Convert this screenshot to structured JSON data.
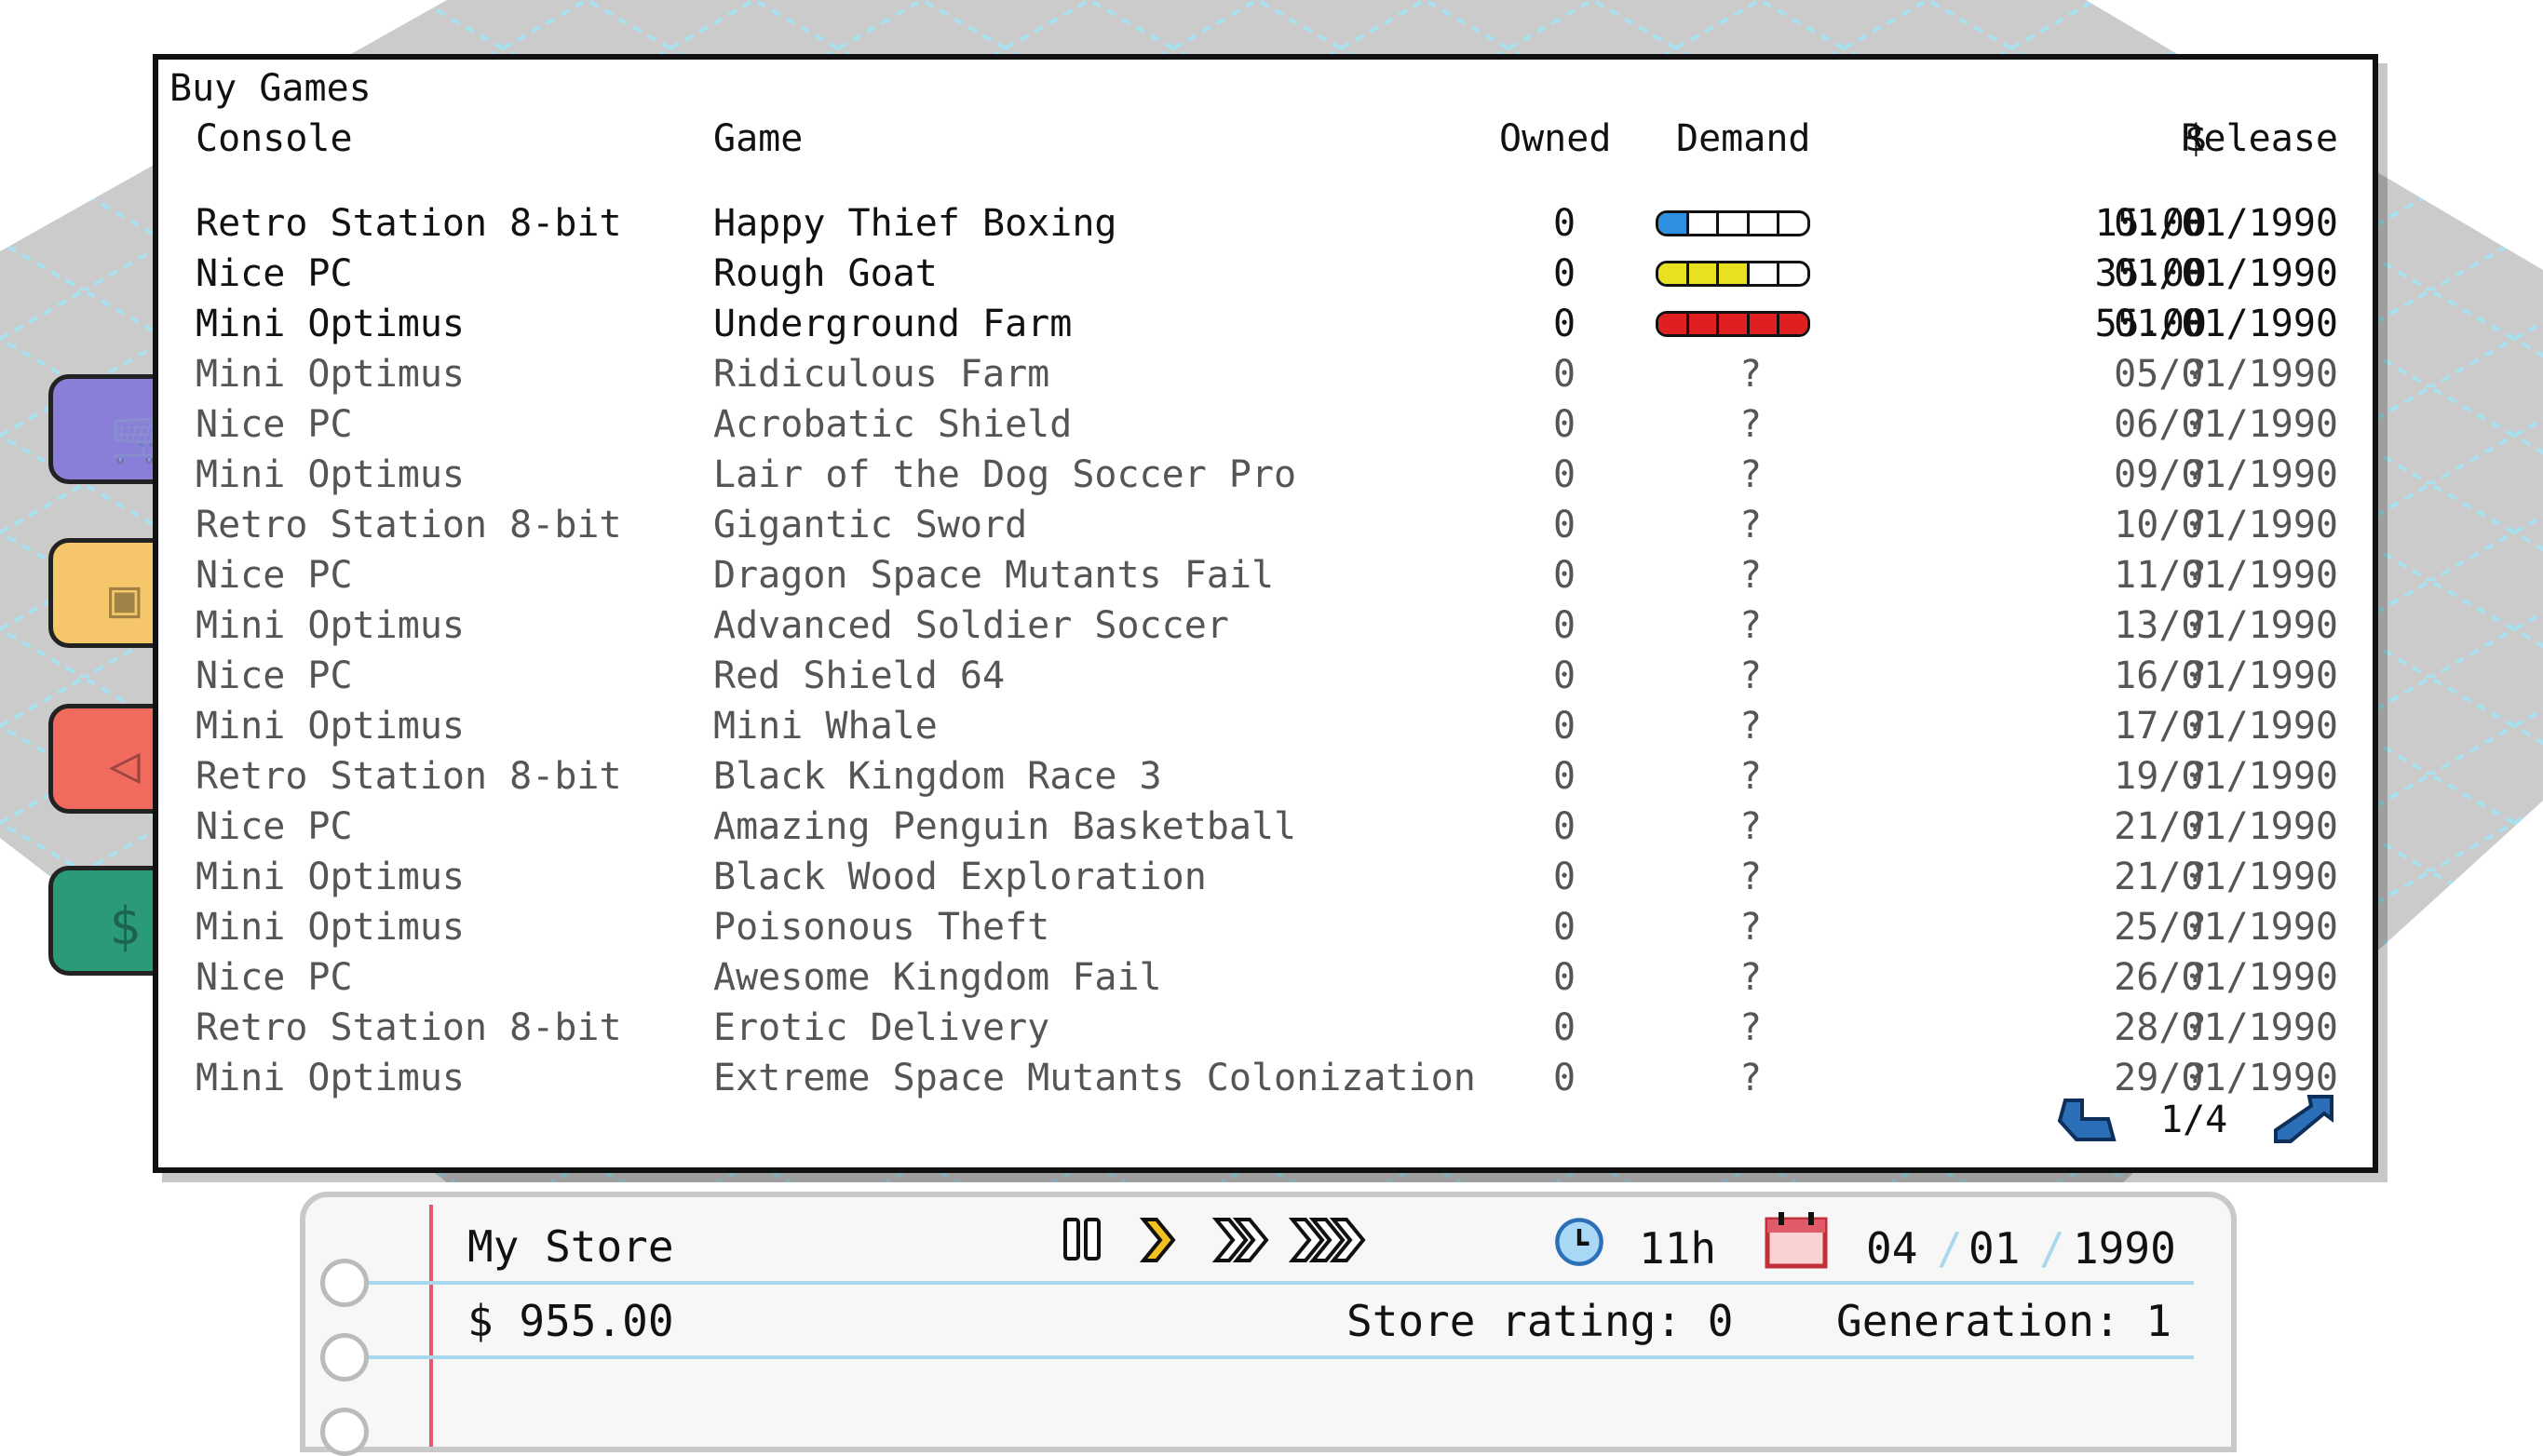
{
  "window": {
    "title": "Buy Games"
  },
  "columns": {
    "console": "Console",
    "game": "Game",
    "owned": "Owned",
    "demand": "Demand",
    "price": "$",
    "release": "Release"
  },
  "rows": [
    {
      "console": "Retro Station 8-bit",
      "game": "Happy Thief Boxing",
      "owned": "0",
      "demand": "?",
      "price": "15.00",
      "release": "01/01/1990",
      "known": true,
      "demand_level": 1,
      "demand_color": "#2f8fe0"
    },
    {
      "console": "Nice PC",
      "game": "Rough Goat",
      "owned": "0",
      "demand": "?",
      "price": "35.00",
      "release": "01/01/1990",
      "known": true,
      "demand_level": 3,
      "demand_color": "#e8e020"
    },
    {
      "console": "Mini Optimus",
      "game": "Underground Farm",
      "owned": "0",
      "demand": "?",
      "price": "55.00",
      "release": "01/01/1990",
      "known": true,
      "demand_level": 5,
      "demand_color": "#e02020"
    },
    {
      "console": "Mini Optimus",
      "game": "Ridiculous Farm",
      "owned": "0",
      "demand": "?",
      "price": "?",
      "release": "05/01/1990",
      "known": false
    },
    {
      "console": "Nice PC",
      "game": "Acrobatic Shield",
      "owned": "0",
      "demand": "?",
      "price": "?",
      "release": "06/01/1990",
      "known": false
    },
    {
      "console": "Mini Optimus",
      "game": "Lair of the Dog Soccer Pro",
      "owned": "0",
      "demand": "?",
      "price": "?",
      "release": "09/01/1990",
      "known": false
    },
    {
      "console": "Retro Station 8-bit",
      "game": "Gigantic Sword",
      "owned": "0",
      "demand": "?",
      "price": "?",
      "release": "10/01/1990",
      "known": false
    },
    {
      "console": "Nice PC",
      "game": "Dragon Space Mutants Fail",
      "owned": "0",
      "demand": "?",
      "price": "?",
      "release": "11/01/1990",
      "known": false
    },
    {
      "console": "Mini Optimus",
      "game": "Advanced Soldier Soccer",
      "owned": "0",
      "demand": "?",
      "price": "?",
      "release": "13/01/1990",
      "known": false
    },
    {
      "console": "Nice PC",
      "game": "Red Shield 64",
      "owned": "0",
      "demand": "?",
      "price": "?",
      "release": "16/01/1990",
      "known": false
    },
    {
      "console": "Mini Optimus",
      "game": "Mini Whale",
      "owned": "0",
      "demand": "?",
      "price": "?",
      "release": "17/01/1990",
      "known": false
    },
    {
      "console": "Retro Station 8-bit",
      "game": "Black Kingdom Race 3",
      "owned": "0",
      "demand": "?",
      "price": "?",
      "release": "19/01/1990",
      "known": false
    },
    {
      "console": "Nice PC",
      "game": "Amazing Penguin Basketball",
      "owned": "0",
      "demand": "?",
      "price": "?",
      "release": "21/01/1990",
      "known": false
    },
    {
      "console": "Mini Optimus",
      "game": "Black Wood Exploration",
      "owned": "0",
      "demand": "?",
      "price": "?",
      "release": "21/01/1990",
      "known": false
    },
    {
      "console": "Mini Optimus",
      "game": "Poisonous Theft",
      "owned": "0",
      "demand": "?",
      "price": "?",
      "release": "25/01/1990",
      "known": false
    },
    {
      "console": "Nice PC",
      "game": "Awesome Kingdom Fail",
      "owned": "0",
      "demand": "?",
      "price": "?",
      "release": "26/01/1990",
      "known": false
    },
    {
      "console": "Retro Station 8-bit",
      "game": "Erotic Delivery",
      "owned": "0",
      "demand": "?",
      "price": "?",
      "release": "28/01/1990",
      "known": false
    },
    {
      "console": "Mini Optimus",
      "game": "Extreme Space Mutants Colonization",
      "owned": "0",
      "demand": "?",
      "price": "?",
      "release": "29/01/1990",
      "known": false
    }
  ],
  "pager": {
    "label": "1/4"
  },
  "status": {
    "store_name": "My Store",
    "money": "$ 955.00",
    "time": "11h",
    "date_day": "04",
    "date_month": "01",
    "date_year": "1990",
    "date_sep": "/",
    "rating": "Store rating: 0",
    "generation": "Generation: 1"
  },
  "side_buttons": [
    {
      "icon": "cart-icon",
      "color": "#8a7fd8"
    },
    {
      "icon": "box-icon",
      "color": "#f5c76a"
    },
    {
      "icon": "tag-icon",
      "color": "#f06a5e"
    },
    {
      "icon": "money-icon",
      "color": "#2b9a78"
    }
  ],
  "colors": {
    "grid_line": "#a8e2f0",
    "floor": "#c9c9c9",
    "window_border": "#111111",
    "pager_arrow": "#2b6fb8",
    "notebook_margin": "#e05a6a"
  }
}
